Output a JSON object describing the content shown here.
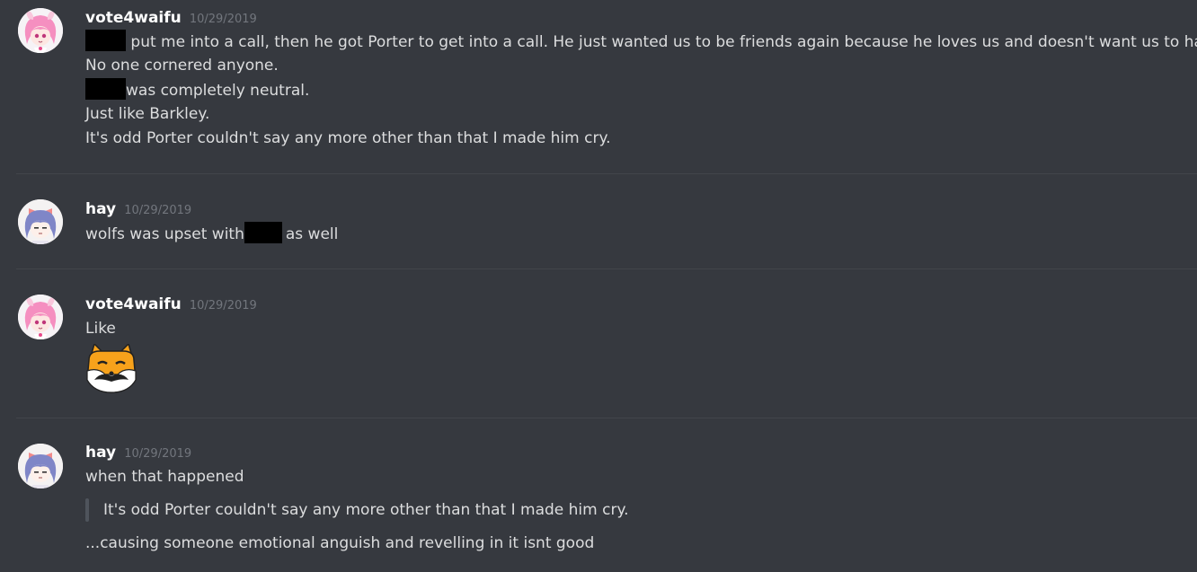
{
  "messages": [
    {
      "username": "vote4waifu",
      "timestamp": "10/29/2019",
      "lines": [
        "put me into a call, then he got Porter to get into a call. He just wanted us to be friends again because he loves us and doesn't want us to hate.",
        "No one cornered anyone.",
        "was completely neutral.",
        "Just like Barkley.",
        "It's odd Porter couldn't say any more other than that I made him cry."
      ]
    },
    {
      "username": "hay",
      "timestamp": "10/29/2019",
      "line_before": "wolfs was upset with",
      "line_after": "as well"
    },
    {
      "username": "vote4waifu",
      "timestamp": "10/29/2019",
      "text": "Like",
      "emoji": "fox-mustache-emoji"
    },
    {
      "username": "hay",
      "timestamp": "10/29/2019",
      "text": "when that happened",
      "quote": "It's odd Porter couldn't say any more other than that I made him cry.",
      "reply": "...causing someone emotional anguish and revelling in it isnt good"
    }
  ],
  "colors": {
    "background": "#36393f",
    "username": "#ffffff",
    "text": "#dcddde",
    "timestamp": "#72767d",
    "redaction": "#000000"
  }
}
